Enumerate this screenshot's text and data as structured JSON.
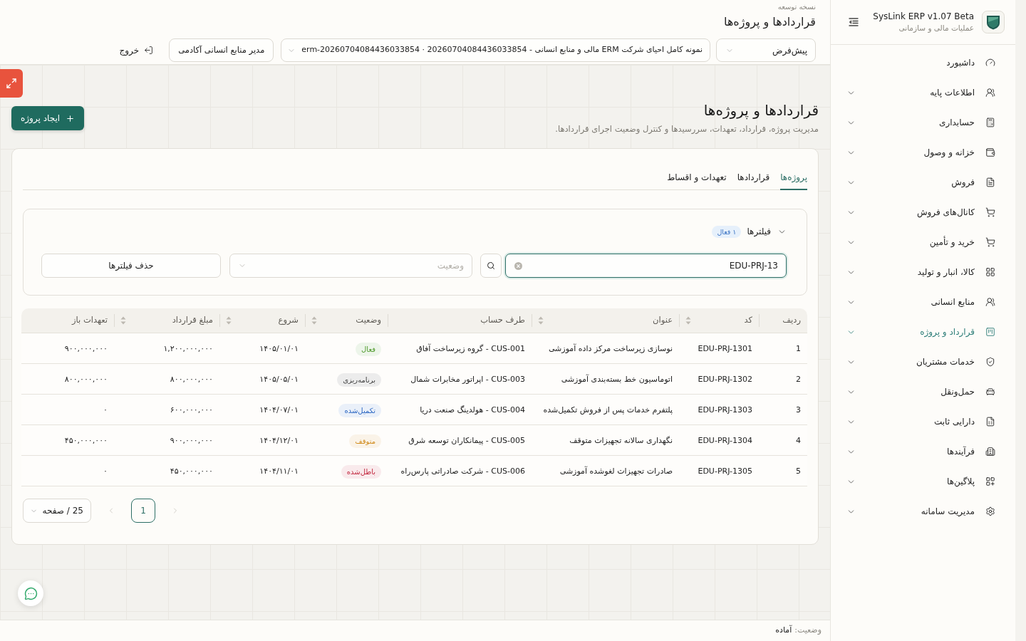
{
  "sidebar": {
    "title": "SysLink ERP v1.07 Beta",
    "subtitle": "عملیات مالی و سازمانی",
    "items": [
      {
        "label": "داشبورد",
        "expandable": false,
        "selected": false
      },
      {
        "label": "اطلاعات پایه",
        "expandable": true,
        "selected": false
      },
      {
        "label": "حسابداری",
        "expandable": true,
        "selected": false
      },
      {
        "label": "خزانه و وصول",
        "expandable": true,
        "selected": false
      },
      {
        "label": "فروش",
        "expandable": true,
        "selected": false
      },
      {
        "label": "کانال‌های فروش",
        "expandable": true,
        "selected": false
      },
      {
        "label": "خرید و تأمین",
        "expandable": true,
        "selected": false
      },
      {
        "label": "کالا، انبار و تولید",
        "expandable": true,
        "selected": false
      },
      {
        "label": "منابع انسانی",
        "expandable": true,
        "selected": false
      },
      {
        "label": "قرارداد و پروژه",
        "expandable": true,
        "selected": true
      },
      {
        "label": "خدمات مشتریان",
        "expandable": true,
        "selected": false
      },
      {
        "label": "حمل‌ونقل",
        "expandable": true,
        "selected": false
      },
      {
        "label": "دارایی ثابت",
        "expandable": true,
        "selected": false
      },
      {
        "label": "فرآیندها",
        "expandable": true,
        "selected": false
      },
      {
        "label": "پلاگین‌ها",
        "expandable": true,
        "selected": false
      },
      {
        "label": "مدیریت سامانه",
        "expandable": true,
        "selected": false
      }
    ]
  },
  "header": {
    "caption": "نسخه توسعه",
    "title": "قراردادها و پروژه‌ها",
    "profile_select": "پیش‌فرض",
    "company_select": "نمونه کامل احیای شرکت ERM مالی و منابع انسانی - 20260704084436033854 · erm-20260704084436033854",
    "role_button": "مدیر منابع انسانی آکادمی",
    "logout_button": "خروج"
  },
  "page": {
    "title": "قراردادها و پروژه‌ها",
    "subtitle": "مدیریت پروژه، قرارداد، تعهدات، سررسیدها و کنترل وضعیت اجرای قراردادها.",
    "create_button": "ایجاد پروژه"
  },
  "tabs": [
    {
      "label": "پروژه‌ها",
      "selected": true
    },
    {
      "label": "قراردادها",
      "selected": false
    },
    {
      "label": "تعهدات و اقساط",
      "selected": false
    }
  ],
  "filters": {
    "title": "فیلترها",
    "expanded": true,
    "badge": "۱ فعال",
    "search": {
      "value": "EDU-PRJ-13"
    },
    "status": {
      "placeholder": "وضعیت"
    },
    "clear_button": "حذف فیلترها"
  },
  "table": {
    "columns": [
      {
        "label": "ردیف",
        "sortable": false
      },
      {
        "label": "کد",
        "sortable": true
      },
      {
        "label": "عنوان",
        "sortable": true
      },
      {
        "label": "طرف حساب",
        "sortable": false
      },
      {
        "label": "وضعیت",
        "sortable": true
      },
      {
        "label": "شروع",
        "sortable": true
      },
      {
        "label": "مبلغ قرارداد",
        "sortable": true
      },
      {
        "label": "تعهدات باز",
        "sortable": false
      }
    ],
    "rows": [
      {
        "index": "1",
        "code": "EDU-PRJ-1301",
        "title": "نوسازی زیرساخت مرکز داده آموزشی",
        "counterparty": "CUS-001 - گروه زیرساخت آفاق",
        "status": {
          "label": "فعال",
          "color": "#4f9a2c"
        },
        "start": "۱۴۰۵/۰۱/۰۱",
        "amount": "۱,۲۰۰,۰۰۰,۰۰۰",
        "open_commitments": "۹۰۰,۰۰۰,۰۰۰"
      },
      {
        "index": "2",
        "code": "EDU-PRJ-1302",
        "title": "اتوماسیون خط بسته‌بندی آموزشی",
        "counterparty": "CUS-003 - اپراتور مخابرات شمال",
        "status": {
          "label": "برنامه‌ریزی",
          "color": "#3d3d3d"
        },
        "start": "۱۴۰۵/۰۵/۰۱",
        "amount": "۸۰۰,۰۰۰,۰۰۰",
        "open_commitments": "۸۰۰,۰۰۰,۰۰۰"
      },
      {
        "index": "3",
        "code": "EDU-PRJ-1303",
        "title": "پلتفرم خدمات پس از فروش تکمیل‌شده",
        "counterparty": "CUS-004 - هولدینگ صنعت دریا",
        "status": {
          "label": "تکمیل‌شده",
          "color": "#2a66c2"
        },
        "start": "۱۴۰۴/۰۷/۰۱",
        "amount": "۶۰۰,۰۰۰,۰۰۰",
        "open_commitments": "۰"
      },
      {
        "index": "4",
        "code": "EDU-PRJ-1304",
        "title": "نگهداری سالانه تجهیزات متوقف",
        "counterparty": "CUS-005 - پیمانکاران توسعه شرق",
        "status": {
          "label": "متوقف",
          "color": "#d08a1a"
        },
        "start": "۱۴۰۴/۱۲/۰۱",
        "amount": "۹۰۰,۰۰۰,۰۰۰",
        "open_commitments": "۴۵۰,۰۰۰,۰۰۰"
      },
      {
        "index": "5",
        "code": "EDU-PRJ-1305",
        "title": "صادرات تجهیزات لغوشده آموزشی",
        "counterparty": "CUS-006 - شرکت صادراتی پارس‌راه",
        "status": {
          "label": "باطل‌شده",
          "color": "#c2283f"
        },
        "start": "۱۴۰۴/۱۱/۰۱",
        "amount": "۴۵۰,۰۰۰,۰۰۰",
        "open_commitments": "۰"
      }
    ]
  },
  "pagination": {
    "prev": {
      "disabled": true
    },
    "pages": [
      {
        "label": "1",
        "selected": true
      }
    ],
    "next": {
      "disabled": true
    },
    "page_size": "25 / صفحه"
  },
  "status_bar": {
    "label": "وضعیت:",
    "value": "آماده"
  }
}
